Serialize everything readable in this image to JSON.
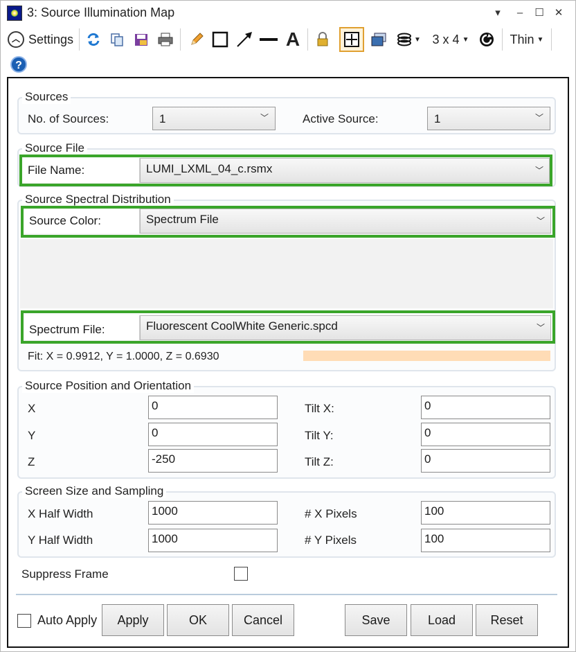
{
  "window": {
    "title": "3: Source Illumination Map",
    "controls": [
      "▾",
      "–",
      "☐",
      "✕"
    ]
  },
  "toolbar": {
    "settings_label": "Settings",
    "layout_label": "3 x 4",
    "line_label": "Thin",
    "help_label": "?"
  },
  "sources": {
    "title": "Sources",
    "num_label": "No. of Sources:",
    "num_value": "1",
    "active_label": "Active Source:",
    "active_value": "1"
  },
  "source_file": {
    "title": "Source File",
    "file_label": "File Name:",
    "file_value": "LUMI_LXML_04_c.rsmx"
  },
  "spectral": {
    "title": "Source Spectral Distribution",
    "color_label": "Source Color:",
    "color_value": "Spectrum File",
    "spectrum_label": "Spectrum File:",
    "spectrum_value": "Fluorescent CoolWhite Generic.spcd",
    "fit_text": "Fit: X = 0.9912, Y = 1.0000, Z = 0.6930",
    "fit_color": "#ffdcb6"
  },
  "position": {
    "title": "Source Position and Orientation",
    "x_label": "X",
    "x_value": "0",
    "y_label": "Y",
    "y_value": "0",
    "z_label": "Z",
    "z_value": "-250",
    "tx_label": "Tilt X:",
    "tx_value": "0",
    "ty_label": "Tilt Y:",
    "ty_value": "0",
    "tz_label": "Tilt Z:",
    "tz_value": "0"
  },
  "screen": {
    "title": "Screen Size and Sampling",
    "xhw_label": "X Half Width",
    "xhw_value": "1000",
    "yhw_label": "Y Half Width",
    "yhw_value": "1000",
    "xpx_label": "# X Pixels",
    "xpx_value": "100",
    "ypx_label": "# Y Pixels",
    "ypx_value": "100"
  },
  "suppress_frame": {
    "label": "Suppress Frame",
    "checked": false
  },
  "footer": {
    "auto_apply_label": "Auto Apply",
    "auto_apply_checked": false,
    "apply": "Apply",
    "ok": "OK",
    "cancel": "Cancel",
    "save": "Save",
    "load": "Load",
    "reset": "Reset"
  },
  "colors": {
    "highlight": "#3aa52a",
    "group_border": "#dfe5ec"
  }
}
